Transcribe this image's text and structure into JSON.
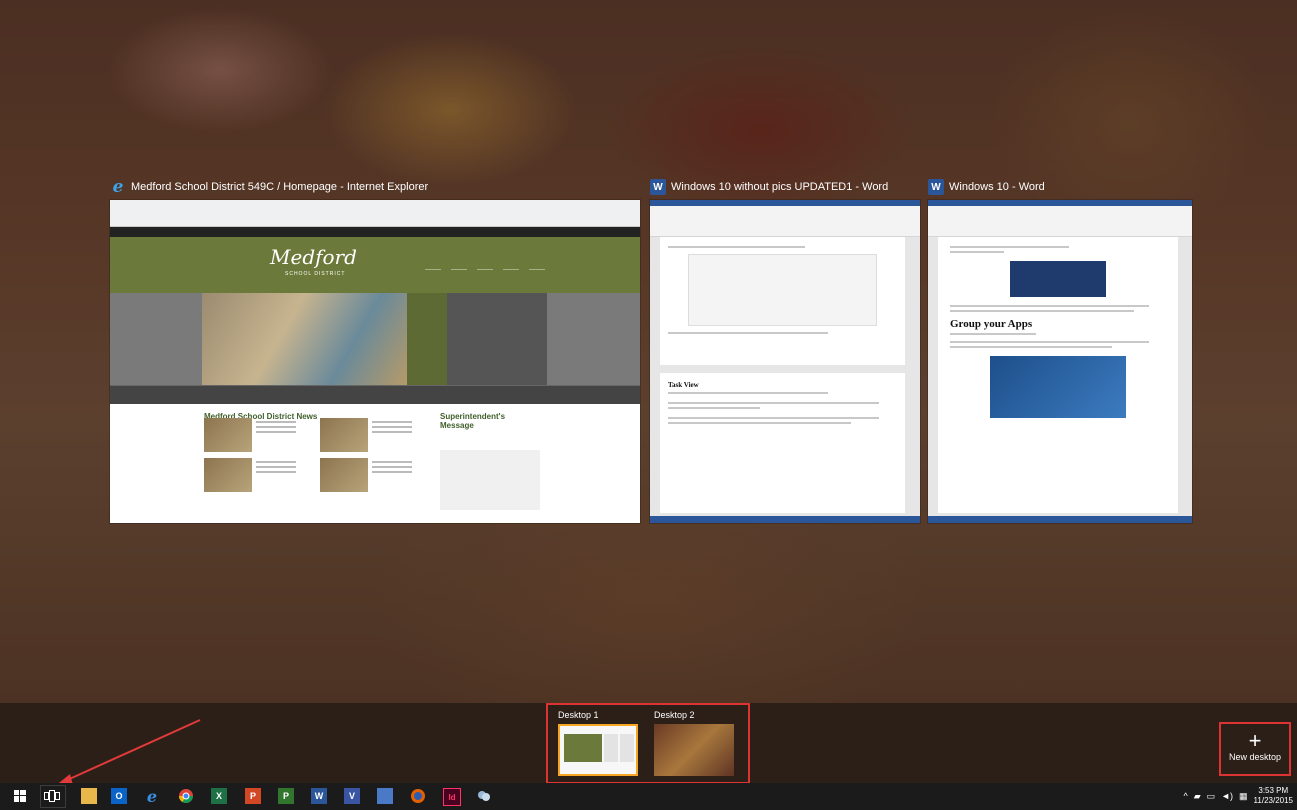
{
  "windows": [
    {
      "title": "Medford School District 549C / Homepage - Internet Explorer",
      "icon": "internet-explorer-icon"
    },
    {
      "title": "Windows 10 without pics UPDATED1 - Word",
      "icon": "word-icon"
    },
    {
      "title": "Windows 10 - Word",
      "icon": "word-icon"
    }
  ],
  "ie_page": {
    "logo": "Medford",
    "logo_sub": "SCHOOL DISTRICT",
    "news_heading": "Medford School District News",
    "superintendent_heading": "Superintendent's Message"
  },
  "word1": {
    "heading": "Task View"
  },
  "word2": {
    "heading": "Group your Apps"
  },
  "desktops": [
    {
      "label": "Desktop 1",
      "active": true
    },
    {
      "label": "Desktop 2",
      "active": false
    }
  ],
  "new_desktop": {
    "label": "New desktop",
    "symbol": "+"
  },
  "taskbar": {
    "items": [
      "start-icon",
      "task-view-icon",
      "file-explorer-icon",
      "outlook-icon",
      "edge-icon",
      "chrome-icon",
      "excel-icon",
      "powerpoint-icon",
      "project-icon",
      "word-icon",
      "visio-icon",
      "network-app-icon",
      "firefox-icon",
      "indesign-icon",
      "settings-app-icon"
    ],
    "indesign_label": "Id"
  },
  "clock": {
    "time": "3:53 PM",
    "date": "11/23/2015"
  },
  "colors": {
    "highlight": "#dd3333",
    "active_desktop_border": "#f5a623",
    "word_blue": "#2b579a",
    "medford_green": "#6b7a3a"
  }
}
